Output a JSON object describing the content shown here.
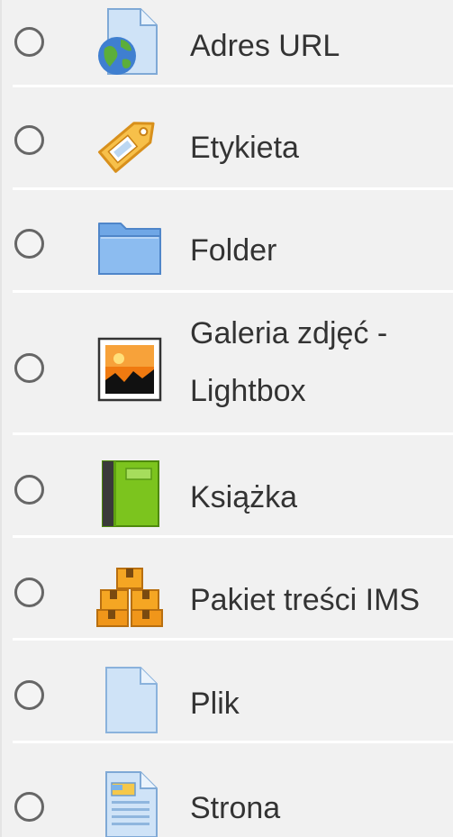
{
  "items": [
    {
      "label": "Adres URL",
      "icon": "url-globe-icon"
    },
    {
      "label": "Etykieta",
      "icon": "label-tag-icon"
    },
    {
      "label": "Folder",
      "icon": "folder-icon"
    },
    {
      "label": "Galeria zdjęć - Lightbox",
      "icon": "image-gallery-icon"
    },
    {
      "label": "Książka",
      "icon": "book-icon"
    },
    {
      "label": "Pakiet treści IMS",
      "icon": "ims-package-icon"
    },
    {
      "label": "Plik",
      "icon": "file-icon"
    },
    {
      "label": "Strona",
      "icon": "page-icon"
    }
  ],
  "colors": {
    "background": "#f1f1f1",
    "separator": "#ffffff",
    "radio_border": "#666666",
    "text": "#333333"
  }
}
